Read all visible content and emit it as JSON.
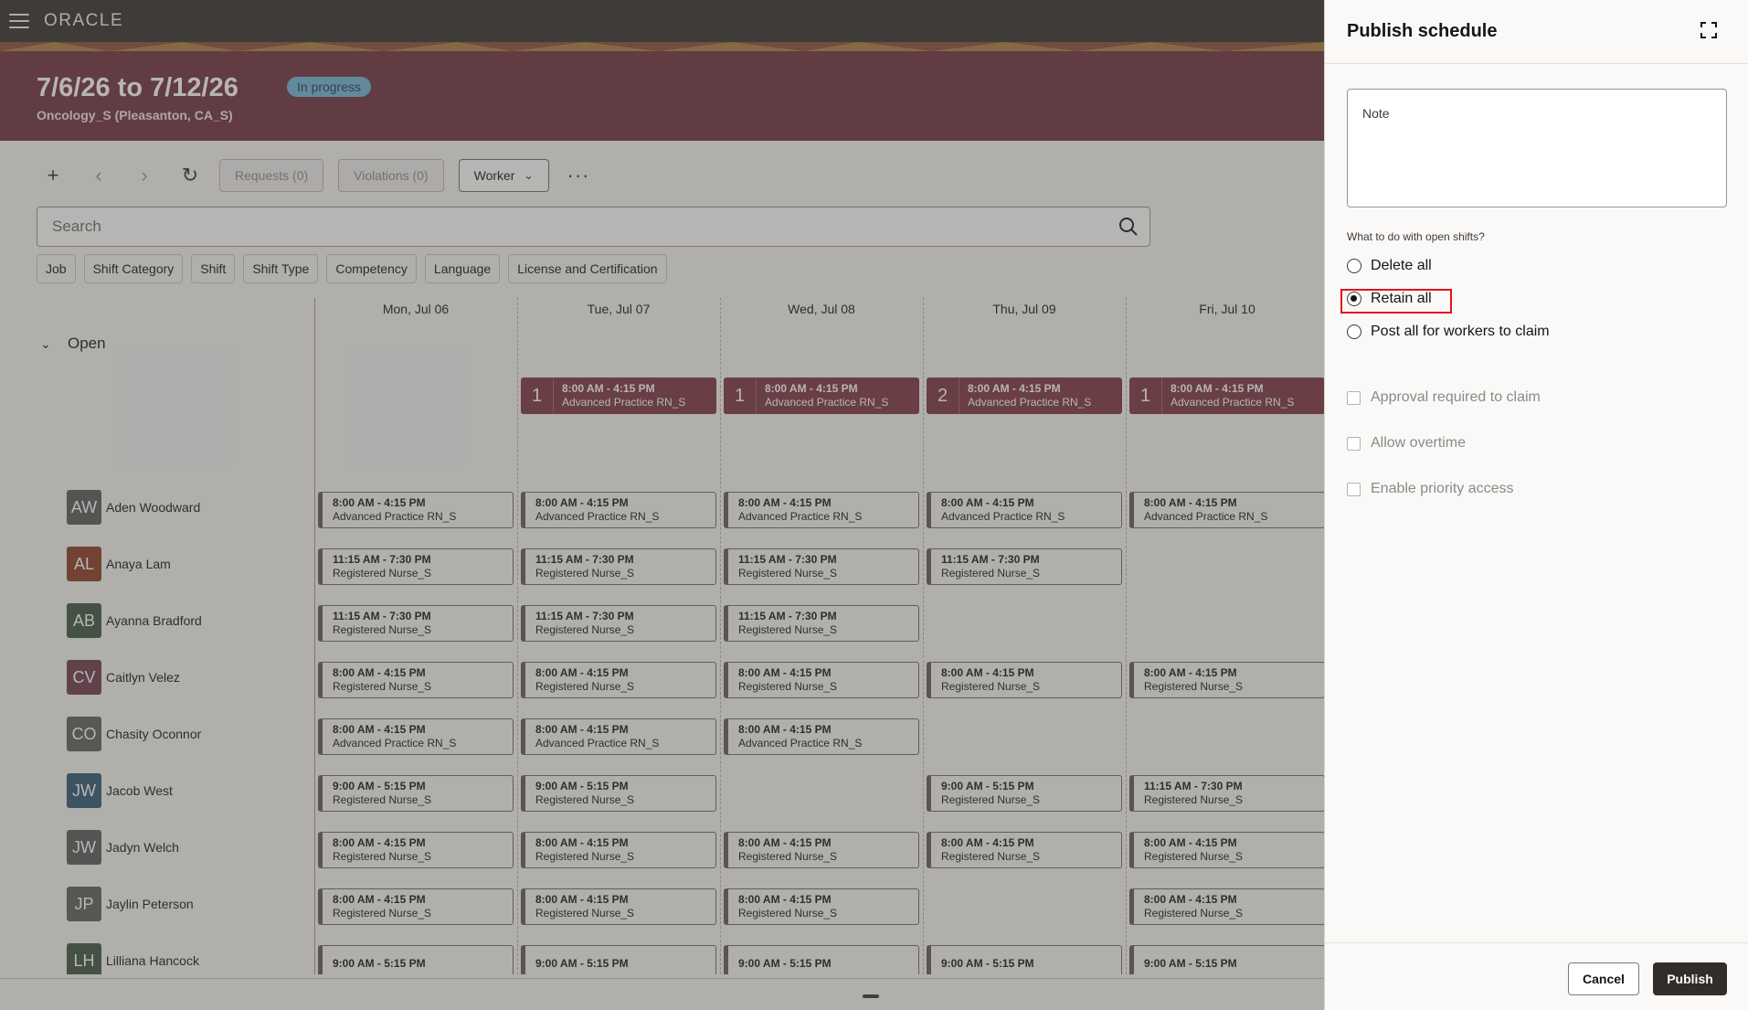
{
  "app": {
    "logo": "ORACLE"
  },
  "banner": {
    "date_range": "7/6/26 to 7/12/26",
    "status": "In progress",
    "org": "Oncology_S (Pleasanton, CA_S)"
  },
  "toolbar": {
    "requests": "Requests (0)",
    "violations": "Violations (0)",
    "view_select": "Worker",
    "icons": [
      "plus-icon",
      "chevron-left-icon",
      "chevron-right-icon",
      "refresh-icon",
      "more-icon"
    ]
  },
  "search": {
    "placeholder": "Search"
  },
  "filters": [
    "Job",
    "Shift Category",
    "Shift",
    "Shift Type",
    "Competency",
    "Language",
    "License and Certification"
  ],
  "days": [
    "Mon, Jul 06",
    "Tue, Jul 07",
    "Wed, Jul 08",
    "Thu, Jul 09",
    "Fri, Jul 10"
  ],
  "open_section": {
    "label": "Open",
    "shifts": [
      null,
      {
        "count": "1",
        "time": "8:00 AM - 4:15 PM",
        "job": "Advanced Practice RN_S"
      },
      {
        "count": "1",
        "time": "8:00 AM - 4:15 PM",
        "job": "Advanced Practice RN_S"
      },
      {
        "count": "2",
        "time": "8:00 AM - 4:15 PM",
        "job": "Advanced Practice RN_S"
      },
      {
        "count": "1",
        "time": "8:00 AM - 4:15 PM",
        "job": "Advanced Practice RN_S"
      }
    ]
  },
  "workers": [
    {
      "initials": "AW",
      "name": "Aden Woodward",
      "color": "#5a5856",
      "shifts": [
        [
          "8:00 AM - 4:15 PM",
          "Advanced Practice RN_S"
        ],
        [
          "8:00 AM - 4:15 PM",
          "Advanced Practice RN_S"
        ],
        [
          "8:00 AM - 4:15 PM",
          "Advanced Practice RN_S"
        ],
        [
          "8:00 AM - 4:15 PM",
          "Advanced Practice RN_S"
        ],
        [
          "8:00 AM - 4:15 PM",
          "Advanced Practice RN_S"
        ]
      ]
    },
    {
      "initials": "AL",
      "name": "Anaya Lam",
      "color": "#8a3b22",
      "shifts": [
        [
          "11:15 AM - 7:30 PM",
          "Registered Nurse_S"
        ],
        [
          "11:15 AM - 7:30 PM",
          "Registered Nurse_S"
        ],
        [
          "11:15 AM - 7:30 PM",
          "Registered Nurse_S"
        ],
        [
          "11:15 AM - 7:30 PM",
          "Registered Nurse_S"
        ],
        null
      ]
    },
    {
      "initials": "AB",
      "name": "Ayanna Bradford",
      "color": "#3d5440",
      "shifts": [
        [
          "11:15 AM - 7:30 PM",
          "Registered Nurse_S"
        ],
        [
          "11:15 AM - 7:30 PM",
          "Registered Nurse_S"
        ],
        [
          "11:15 AM - 7:30 PM",
          "Registered Nurse_S"
        ],
        null,
        null
      ]
    },
    {
      "initials": "CV",
      "name": "Caitlyn Velez",
      "color": "#6d3a4a",
      "shifts": [
        [
          "8:00 AM - 4:15 PM",
          "Registered Nurse_S"
        ],
        [
          "8:00 AM - 4:15 PM",
          "Registered Nurse_S"
        ],
        [
          "8:00 AM - 4:15 PM",
          "Registered Nurse_S"
        ],
        [
          "8:00 AM - 4:15 PM",
          "Registered Nurse_S"
        ],
        [
          "8:00 AM - 4:15 PM",
          "Registered Nurse_S"
        ]
      ]
    },
    {
      "initials": "CO",
      "name": "Chasity Oconnor",
      "color": "#5f5d5b",
      "shifts": [
        [
          "8:00 AM - 4:15 PM",
          "Advanced Practice RN_S"
        ],
        [
          "8:00 AM - 4:15 PM",
          "Advanced Practice RN_S"
        ],
        [
          "8:00 AM - 4:15 PM",
          "Advanced Practice RN_S"
        ],
        null,
        null
      ]
    },
    {
      "initials": "JW",
      "name": "Jacob West",
      "color": "#2e5670",
      "shifts": [
        [
          "9:00 AM - 5:15 PM",
          "Registered Nurse_S"
        ],
        [
          "9:00 AM - 5:15 PM",
          "Registered Nurse_S"
        ],
        null,
        [
          "9:00 AM - 5:15 PM",
          "Registered Nurse_S"
        ],
        [
          "11:15 AM - 7:30 PM",
          "Registered Nurse_S"
        ]
      ]
    },
    {
      "initials": "JW",
      "name": "Jadyn Welch",
      "color": "#5a5856",
      "shifts": [
        [
          "8:00 AM - 4:15 PM",
          "Registered Nurse_S"
        ],
        [
          "8:00 AM - 4:15 PM",
          "Registered Nurse_S"
        ],
        [
          "8:00 AM - 4:15 PM",
          "Registered Nurse_S"
        ],
        [
          "8:00 AM - 4:15 PM",
          "Registered Nurse_S"
        ],
        [
          "8:00 AM - 4:15 PM",
          "Registered Nurse_S"
        ]
      ]
    },
    {
      "initials": "JP",
      "name": "Jaylin Peterson",
      "color": "#5f5d5b",
      "shifts": [
        [
          "8:00 AM - 4:15 PM",
          "Registered Nurse_S"
        ],
        [
          "8:00 AM - 4:15 PM",
          "Registered Nurse_S"
        ],
        [
          "8:00 AM - 4:15 PM",
          "Registered Nurse_S"
        ],
        null,
        [
          "8:00 AM - 4:15 PM",
          "Registered Nurse_S"
        ]
      ]
    },
    {
      "initials": "LH",
      "name": "Lilliana Hancock",
      "color": "#3d5440",
      "shifts": [
        [
          "9:00 AM - 5:15 PM",
          ""
        ],
        [
          "9:00 AM - 5:15 PM",
          ""
        ],
        [
          "9:00 AM - 5:15 PM",
          ""
        ],
        [
          "9:00 AM - 5:15 PM",
          ""
        ],
        [
          "9:00 AM - 5:15 PM",
          ""
        ]
      ]
    }
  ],
  "drawer": {
    "title": "Publish schedule",
    "note_label": "Note",
    "open_shifts_question": "What to do with open shifts?",
    "options": [
      {
        "label": "Delete all",
        "selected": false
      },
      {
        "label": "Retain all",
        "selected": true
      },
      {
        "label": "Post all for workers to claim",
        "selected": false
      }
    ],
    "checkboxes": [
      {
        "label": "Approval required to claim",
        "checked": false,
        "disabled": true
      },
      {
        "label": "Allow overtime",
        "checked": false,
        "disabled": true
      },
      {
        "label": "Enable priority access",
        "checked": false,
        "disabled": true
      }
    ],
    "cancel": "Cancel",
    "publish": "Publish"
  }
}
